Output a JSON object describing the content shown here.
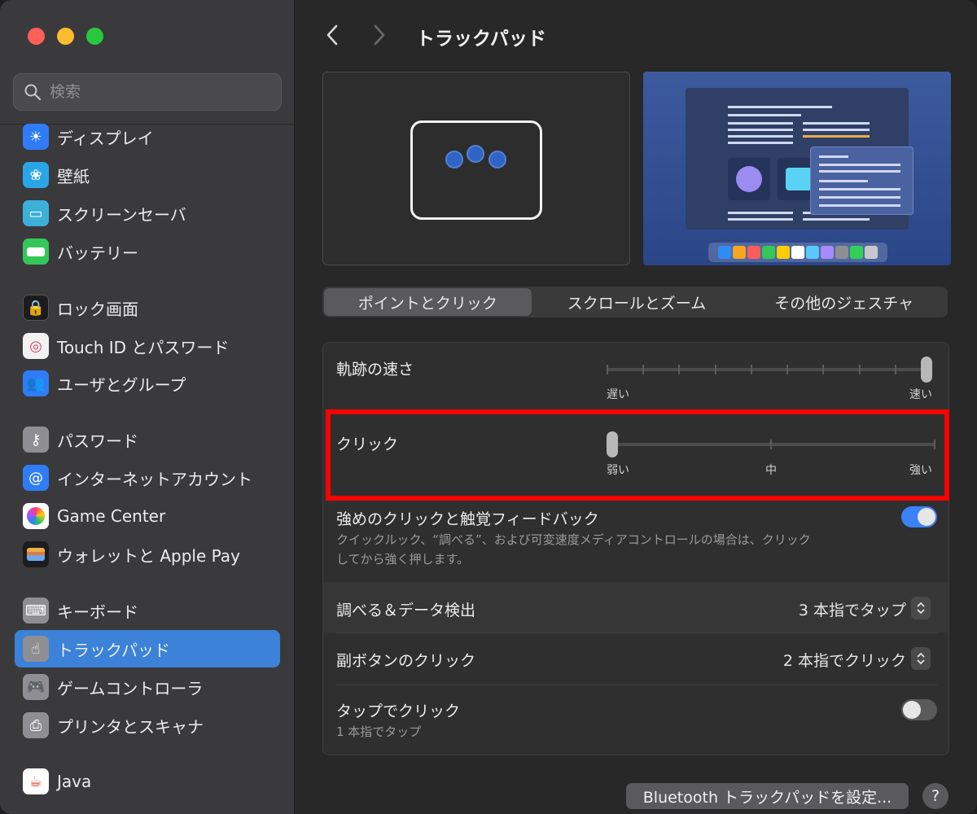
{
  "sidebar": {
    "search_placeholder": "検索",
    "items": [
      {
        "label": "ディスプレイ",
        "icon": "display-icon",
        "color": "#2f7cf6"
      },
      {
        "label": "壁紙",
        "icon": "wallpaper-icon",
        "color": "#2aa6e8"
      },
      {
        "label": "スクリーンセーバ",
        "icon": "screensaver-icon",
        "color": "#3cb0d8"
      },
      {
        "label": "バッテリー",
        "icon": "battery-icon",
        "color": "#34c759"
      },
      {
        "label": "ロック画面",
        "icon": "lock-icon",
        "color": "#1c1c1e"
      },
      {
        "label": "Touch ID とパスワード",
        "icon": "fingerprint-icon",
        "color": "#f2f2f2"
      },
      {
        "label": "ユーザとグループ",
        "icon": "users-icon",
        "color": "#2f7cf6"
      },
      {
        "label": "パスワード",
        "icon": "key-icon",
        "color": "#8e8e93"
      },
      {
        "label": "インターネットアカウント",
        "icon": "at-icon",
        "color": "#2f7cf6"
      },
      {
        "label": "Game Center",
        "icon": "game-center-icon",
        "color": "#ffffff"
      },
      {
        "label": "ウォレットと Apple Pay",
        "icon": "wallet-icon",
        "color": "#1c1c1e"
      },
      {
        "label": "キーボード",
        "icon": "keyboard-icon",
        "color": "#8e8e93"
      },
      {
        "label": "トラックパッド",
        "icon": "trackpad-icon",
        "color": "#8e8e93",
        "selected": true
      },
      {
        "label": "ゲームコントローラ",
        "icon": "gamepad-icon",
        "color": "#8e8e93"
      },
      {
        "label": "プリンタとスキャナ",
        "icon": "printer-icon",
        "color": "#8e8e93"
      },
      {
        "label": "Java",
        "icon": "java-icon",
        "color": "#ffffff"
      }
    ]
  },
  "main": {
    "title": "トラックパッド",
    "tabs": [
      {
        "label": "ポイントとクリック",
        "active": true
      },
      {
        "label": "スクロールとズーム",
        "active": false
      },
      {
        "label": "その他のジェスチャ",
        "active": false
      }
    ],
    "tracking": {
      "label": "軌跡の速さ",
      "min_label": "遅い",
      "max_label": "速い",
      "value_fraction": 1.0,
      "ticks": 10
    },
    "click": {
      "label": "クリック",
      "min_label": "弱い",
      "mid_label": "中",
      "max_label": "強い",
      "value_fraction": 0.0
    },
    "force_click": {
      "label": "強めのクリックと触覚フィードバック",
      "description_line1": "クイックルック、“調べる”、および可変速度メディアコントロールの場合は、クリック",
      "description_line2": "してから強く押します。",
      "enabled": true
    },
    "lookup": {
      "label": "調べる＆データ検出",
      "value": "3 本指でタップ"
    },
    "secondary_click": {
      "label": "副ボタンのクリック",
      "value": "2 本指でクリック"
    },
    "tap_to_click": {
      "label": "タップでクリック",
      "sub": "1 本指でタップ",
      "enabled": false
    },
    "bluetooth_button": "Bluetooth トラックパッドを設定...",
    "help_button": "?"
  },
  "colors": {
    "accent": "#3b82f6",
    "highlight_box": "#ff0000",
    "selected_sidebar": "#3b82d8"
  }
}
